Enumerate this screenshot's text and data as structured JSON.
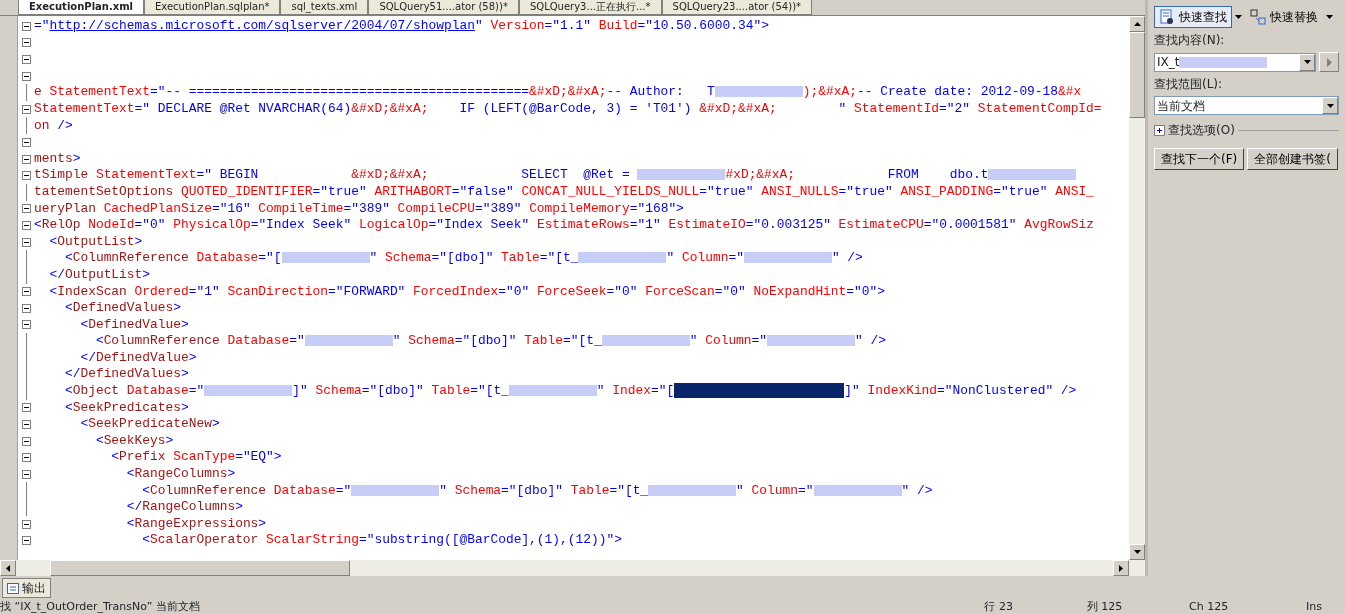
{
  "tabs": [
    {
      "label": "ExecutionPlan.xml",
      "selected": true
    },
    {
      "label": "ExecutionPlan.sqlplan*",
      "selected": false
    },
    {
      "label": "sql_texts.xml",
      "selected": false
    },
    {
      "label": "SQLQuery51....ator (58))*",
      "selected": false
    },
    {
      "label": "SQLQuery3...正在执行...*",
      "selected": false
    },
    {
      "label": "SQLQuery23....ator (54))*",
      "selected": false
    }
  ],
  "editor": {
    "lines": [
      {
        "collapsible": true,
        "tokens": [
          {
            "kind": "value",
            "text": "=\""
          },
          {
            "kind": "link",
            "text": "http://schemas.microsoft.com/sqlserver/2004/07/showplan"
          },
          {
            "kind": "value",
            "text": "\""
          },
          {
            "kind": "attr",
            "text": " Version"
          },
          {
            "kind": "value",
            "text": "=\"1.1\""
          },
          {
            "kind": "attr",
            "text": " Build"
          },
          {
            "kind": "value",
            "text": "=\"10.50.6000.34\">"
          }
        ]
      },
      {
        "collapsible": true
      },
      {
        "collapsible": true
      },
      {
        "collapsible": true
      },
      {
        "collapsible": false,
        "tokens": [
          {
            "kind": "tag",
            "text": "e"
          },
          {
            "kind": "attr",
            "text": " StatementText"
          },
          {
            "kind": "value",
            "text": "=\"-- ============================================"
          },
          {
            "kind": "attr",
            "text": "&#xD;&#xA;"
          },
          {
            "kind": "value",
            "text": "-- Author:   T"
          },
          {
            "kind": "redacted"
          },
          {
            "kind": "attr",
            "text": ");&#xA;"
          },
          {
            "kind": "value",
            "text": "-- Create date: 2012-09-18"
          },
          {
            "kind": "attr",
            "text": "&#x"
          }
        ]
      },
      {
        "collapsible": true,
        "tokens": [
          {
            "kind": "attr",
            "text": "StatementText"
          },
          {
            "kind": "value",
            "text": "=\" DECLARE @Ret NVARCHAR(64)"
          },
          {
            "kind": "attr",
            "text": "&#xD;&#xA;"
          },
          {
            "kind": "value",
            "text": "    IF (LEFT(@BarCode, 3) = 'T01') "
          },
          {
            "kind": "attr",
            "text": "&#xD;&#xA;"
          },
          {
            "kind": "value",
            "text": "        \""
          },
          {
            "kind": "attr",
            "text": " StatementId"
          },
          {
            "kind": "value",
            "text": "=\"2\""
          },
          {
            "kind": "attr",
            "text": " StatementCompId="
          }
        ]
      },
      {
        "collapsible": false,
        "tokens": [
          {
            "kind": "tag",
            "text": "on"
          },
          {
            "kind": "value",
            "text": " />"
          }
        ]
      },
      {
        "collapsible": true
      },
      {
        "collapsible": true,
        "tokens": [
          {
            "kind": "tag",
            "text": "ments"
          },
          {
            "kind": "value",
            "text": ">"
          }
        ]
      },
      {
        "collapsible": true,
        "tokens": [
          {
            "kind": "tag",
            "text": "tSimple"
          },
          {
            "kind": "attr",
            "text": " StatementText"
          },
          {
            "kind": "value",
            "text": "=\" BEGIN            "
          },
          {
            "kind": "attr",
            "text": "&#xD;&#xA;"
          },
          {
            "kind": "value",
            "text": "            SELECT  @Ret = "
          },
          {
            "kind": "redacted"
          },
          {
            "kind": "attr",
            "text": "#xD;&#xA;"
          },
          {
            "kind": "value",
            "text": "            FROM    dbo.t"
          },
          {
            "kind": "redacted"
          }
        ]
      },
      {
        "collapsible": false,
        "tokens": [
          {
            "kind": "tag",
            "text": "tatementSetOptions"
          },
          {
            "kind": "attr",
            "text": " QUOTED_IDENTIFIER"
          },
          {
            "kind": "value",
            "text": "=\"true\""
          },
          {
            "kind": "attr",
            "text": " ARITHABORT"
          },
          {
            "kind": "value",
            "text": "=\"false\""
          },
          {
            "kind": "attr",
            "text": " CONCAT_NULL_YIELDS_NULL"
          },
          {
            "kind": "value",
            "text": "=\"true\""
          },
          {
            "kind": "attr",
            "text": " ANSI_NULLS"
          },
          {
            "kind": "value",
            "text": "=\"true\""
          },
          {
            "kind": "attr",
            "text": " ANSI_PADDING"
          },
          {
            "kind": "value",
            "text": "=\"true\""
          },
          {
            "kind": "attr",
            "text": " ANSI_"
          }
        ]
      },
      {
        "collapsible": true,
        "tokens": [
          {
            "kind": "tag",
            "text": "ueryPlan"
          },
          {
            "kind": "attr",
            "text": " CachedPlanSize"
          },
          {
            "kind": "value",
            "text": "=\"16\""
          },
          {
            "kind": "attr",
            "text": " CompileTime"
          },
          {
            "kind": "value",
            "text": "=\"389\""
          },
          {
            "kind": "attr",
            "text": " CompileCPU"
          },
          {
            "kind": "value",
            "text": "=\"389\""
          },
          {
            "kind": "attr",
            "text": " CompileMemory"
          },
          {
            "kind": "value",
            "text": "=\"168\">"
          }
        ]
      },
      {
        "collapsible": true,
        "tokens": [
          {
            "kind": "value",
            "text": "<"
          },
          {
            "kind": "tag",
            "text": "RelOp"
          },
          {
            "kind": "attr",
            "text": " NodeId"
          },
          {
            "kind": "value",
            "text": "=\"0\""
          },
          {
            "kind": "attr",
            "text": " PhysicalOp"
          },
          {
            "kind": "value",
            "text": "=\"Index Seek\""
          },
          {
            "kind": "attr",
            "text": " LogicalOp"
          },
          {
            "kind": "value",
            "text": "=\"Index Seek\""
          },
          {
            "kind": "attr",
            "text": " EstimateRows"
          },
          {
            "kind": "value",
            "text": "=\"1\""
          },
          {
            "kind": "attr",
            "text": " EstimateIO"
          },
          {
            "kind": "value",
            "text": "=\"0.003125\""
          },
          {
            "kind": "attr",
            "text": " EstimateCPU"
          },
          {
            "kind": "value",
            "text": "=\"0.0001581\""
          },
          {
            "kind": "attr",
            "text": " AvgRowSiz"
          }
        ]
      },
      {
        "collapsible": true,
        "tokens": [
          {
            "kind": "value",
            "text": "  <"
          },
          {
            "kind": "tag",
            "text": "OutputList"
          },
          {
            "kind": "value",
            "text": ">"
          }
        ]
      },
      {
        "collapsible": false,
        "tokens": [
          {
            "kind": "value",
            "text": "    <"
          },
          {
            "kind": "tag",
            "text": "ColumnReference"
          },
          {
            "kind": "attr",
            "text": " Database"
          },
          {
            "kind": "value",
            "text": "=\"["
          },
          {
            "kind": "redacted"
          },
          {
            "kind": "value",
            "text": "\""
          },
          {
            "kind": "attr",
            "text": " Schema"
          },
          {
            "kind": "value",
            "text": "=\"[dbo]\""
          },
          {
            "kind": "attr",
            "text": " Table"
          },
          {
            "kind": "value",
            "text": "=\"[t_"
          },
          {
            "kind": "redacted"
          },
          {
            "kind": "value",
            "text": "\""
          },
          {
            "kind": "attr",
            "text": " Column"
          },
          {
            "kind": "value",
            "text": "=\""
          },
          {
            "kind": "redacted"
          },
          {
            "kind": "value",
            "text": "\" />"
          }
        ]
      },
      {
        "collapsible": false,
        "tokens": [
          {
            "kind": "value",
            "text": "  </"
          },
          {
            "kind": "tag",
            "text": "OutputList"
          },
          {
            "kind": "value",
            "text": ">"
          }
        ]
      },
      {
        "collapsible": true,
        "tokens": [
          {
            "kind": "value",
            "text": "  <"
          },
          {
            "kind": "tag",
            "text": "IndexScan"
          },
          {
            "kind": "attr",
            "text": " Ordered"
          },
          {
            "kind": "value",
            "text": "=\"1\""
          },
          {
            "kind": "attr",
            "text": " ScanDirection"
          },
          {
            "kind": "value",
            "text": "=\"FORWARD\""
          },
          {
            "kind": "attr",
            "text": " ForcedIndex"
          },
          {
            "kind": "value",
            "text": "=\"0\""
          },
          {
            "kind": "attr",
            "text": " ForceSeek"
          },
          {
            "kind": "value",
            "text": "=\"0\""
          },
          {
            "kind": "attr",
            "text": " ForceScan"
          },
          {
            "kind": "value",
            "text": "=\"0\""
          },
          {
            "kind": "attr",
            "text": " NoExpandHint"
          },
          {
            "kind": "value",
            "text": "=\"0\">"
          }
        ]
      },
      {
        "collapsible": true,
        "tokens": [
          {
            "kind": "value",
            "text": "    <"
          },
          {
            "kind": "tag",
            "text": "DefinedValues"
          },
          {
            "kind": "value",
            "text": ">"
          }
        ]
      },
      {
        "collapsible": true,
        "tokens": [
          {
            "kind": "value",
            "text": "      <"
          },
          {
            "kind": "tag",
            "text": "DefinedValue"
          },
          {
            "kind": "value",
            "text": ">"
          }
        ]
      },
      {
        "collapsible": false,
        "tokens": [
          {
            "kind": "value",
            "text": "        <"
          },
          {
            "kind": "tag",
            "text": "ColumnReference"
          },
          {
            "kind": "attr",
            "text": " Database"
          },
          {
            "kind": "value",
            "text": "=\""
          },
          {
            "kind": "redacted"
          },
          {
            "kind": "value",
            "text": "\""
          },
          {
            "kind": "attr",
            "text": " Schema"
          },
          {
            "kind": "value",
            "text": "=\"[dbo]\""
          },
          {
            "kind": "attr",
            "text": " Table"
          },
          {
            "kind": "value",
            "text": "=\"[t_"
          },
          {
            "kind": "redacted"
          },
          {
            "kind": "value",
            "text": "\""
          },
          {
            "kind": "attr",
            "text": " Column"
          },
          {
            "kind": "value",
            "text": "=\""
          },
          {
            "kind": "redacted"
          },
          {
            "kind": "value",
            "text": "\" />"
          }
        ]
      },
      {
        "collapsible": false,
        "tokens": [
          {
            "kind": "value",
            "text": "      </"
          },
          {
            "kind": "tag",
            "text": "DefinedValue"
          },
          {
            "kind": "value",
            "text": ">"
          }
        ]
      },
      {
        "collapsible": false,
        "tokens": [
          {
            "kind": "value",
            "text": "    </"
          },
          {
            "kind": "tag",
            "text": "DefinedValues"
          },
          {
            "kind": "value",
            "text": ">"
          }
        ]
      },
      {
        "collapsible": false,
        "tokens": [
          {
            "kind": "value",
            "text": "    <"
          },
          {
            "kind": "tag",
            "text": "Object"
          },
          {
            "kind": "attr",
            "text": " Database"
          },
          {
            "kind": "value",
            "text": "=\""
          },
          {
            "kind": "redacted"
          },
          {
            "kind": "value",
            "text": "]\""
          },
          {
            "kind": "attr",
            "text": " Schema"
          },
          {
            "kind": "value",
            "text": "=\"[dbo]\""
          },
          {
            "kind": "attr",
            "text": " Table"
          },
          {
            "kind": "value",
            "text": "=\"[t_"
          },
          {
            "kind": "redacted"
          },
          {
            "kind": "value",
            "text": "\""
          },
          {
            "kind": "attr",
            "text": " Index"
          },
          {
            "kind": "value",
            "text": "=\"["
          },
          {
            "kind": "selection"
          },
          {
            "kind": "value",
            "text": "]\""
          },
          {
            "kind": "attr",
            "text": " IndexKind"
          },
          {
            "kind": "value",
            "text": "=\"NonClustered\" />"
          }
        ]
      },
      {
        "collapsible": true,
        "tokens": [
          {
            "kind": "value",
            "text": "    <"
          },
          {
            "kind": "tag",
            "text": "SeekPredicates"
          },
          {
            "kind": "value",
            "text": ">"
          }
        ]
      },
      {
        "collapsible": true,
        "tokens": [
          {
            "kind": "value",
            "text": "      <"
          },
          {
            "kind": "tag",
            "text": "SeekPredicateNew"
          },
          {
            "kind": "value",
            "text": ">"
          }
        ]
      },
      {
        "collapsible": true,
        "tokens": [
          {
            "kind": "value",
            "text": "        <"
          },
          {
            "kind": "tag",
            "text": "SeekKeys"
          },
          {
            "kind": "value",
            "text": ">"
          }
        ]
      },
      {
        "collapsible": true,
        "tokens": [
          {
            "kind": "value",
            "text": "          <"
          },
          {
            "kind": "tag",
            "text": "Prefix"
          },
          {
            "kind": "attr",
            "text": " ScanType"
          },
          {
            "kind": "value",
            "text": "=\"EQ\">"
          }
        ]
      },
      {
        "collapsible": true,
        "tokens": [
          {
            "kind": "value",
            "text": "            <"
          },
          {
            "kind": "tag",
            "text": "RangeColumns"
          },
          {
            "kind": "value",
            "text": ">"
          }
        ]
      },
      {
        "collapsible": false,
        "tokens": [
          {
            "kind": "value",
            "text": "              <"
          },
          {
            "kind": "tag",
            "text": "ColumnReference"
          },
          {
            "kind": "attr",
            "text": " Database"
          },
          {
            "kind": "value",
            "text": "=\""
          },
          {
            "kind": "redacted"
          },
          {
            "kind": "value",
            "text": "\""
          },
          {
            "kind": "attr",
            "text": " Schema"
          },
          {
            "kind": "value",
            "text": "=\"[dbo]\""
          },
          {
            "kind": "attr",
            "text": " Table"
          },
          {
            "kind": "value",
            "text": "=\"[t_"
          },
          {
            "kind": "redacted"
          },
          {
            "kind": "value",
            "text": "\""
          },
          {
            "kind": "attr",
            "text": " Column"
          },
          {
            "kind": "value",
            "text": "=\""
          },
          {
            "kind": "redacted"
          },
          {
            "kind": "value",
            "text": "\" />"
          }
        ]
      },
      {
        "collapsible": false,
        "tokens": [
          {
            "kind": "value",
            "text": "            </"
          },
          {
            "kind": "tag",
            "text": "RangeColumns"
          },
          {
            "kind": "value",
            "text": ">"
          }
        ]
      },
      {
        "collapsible": true,
        "tokens": [
          {
            "kind": "value",
            "text": "            <"
          },
          {
            "kind": "tag",
            "text": "RangeExpressions"
          },
          {
            "kind": "value",
            "text": ">"
          }
        ]
      },
      {
        "collapsible": true,
        "tokens": [
          {
            "kind": "value",
            "text": "              <"
          },
          {
            "kind": "tag",
            "text": "ScalarOperator"
          },
          {
            "kind": "attr",
            "text": " ScalarString"
          },
          {
            "kind": "value",
            "text": "=\"substring([@BarCode],(1),(12))\">"
          }
        ]
      }
    ]
  },
  "find_panel": {
    "modes": [
      {
        "label": "快速查找",
        "selected": true
      },
      {
        "label": "快速替换",
        "selected": false
      }
    ],
    "find_label": "查找内容(N):",
    "find_value": "IX_t",
    "scope_label": "查找范围(L):",
    "scope_value": "当前文档",
    "options": {
      "label": "查找选项(O)",
      "expanded": false
    },
    "buttons": [
      "查找下一个(F)",
      "全部创建书签("
    ]
  },
  "output_tab": "输出",
  "status_bar": {
    "message": "找 “IX_t_OutOrder_TransNo” 当前文档",
    "line": "行 23",
    "column": "列 125",
    "char": "Ch 125",
    "mode": "Ins"
  }
}
